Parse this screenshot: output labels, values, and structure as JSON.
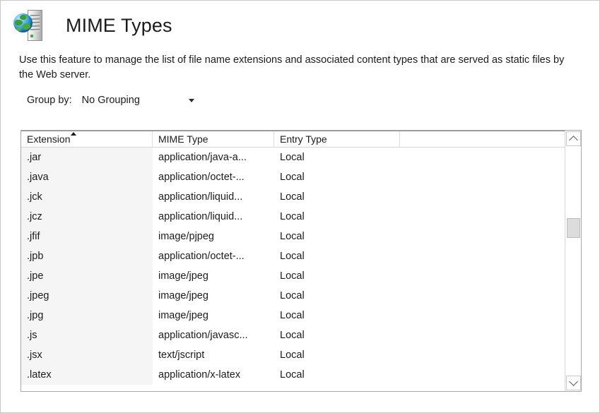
{
  "page": {
    "title": "MIME Types",
    "icon": "globe-server-icon",
    "description": "Use this feature to manage the list of file name extensions and associated content types that are served as static files by the Web server."
  },
  "toolbar": {
    "group_by_label": "Group by:",
    "group_by_value": "No Grouping",
    "group_by_caret": "chevron-down-icon"
  },
  "grid": {
    "columns": [
      {
        "label": "Extension",
        "sorted": "ascending"
      },
      {
        "label": "MIME Type",
        "sorted": ""
      },
      {
        "label": "Entry Type",
        "sorted": ""
      },
      {
        "label": "",
        "sorted": ""
      }
    ],
    "rows": [
      {
        "extension": ".jar",
        "mime_type": "application/java-a...",
        "entry_type": "Local"
      },
      {
        "extension": ".java",
        "mime_type": "application/octet-...",
        "entry_type": "Local"
      },
      {
        "extension": ".jck",
        "mime_type": "application/liquid...",
        "entry_type": "Local"
      },
      {
        "extension": ".jcz",
        "mime_type": "application/liquid...",
        "entry_type": "Local"
      },
      {
        "extension": ".jfif",
        "mime_type": "image/pjpeg",
        "entry_type": "Local"
      },
      {
        "extension": ".jpb",
        "mime_type": "application/octet-...",
        "entry_type": "Local"
      },
      {
        "extension": ".jpe",
        "mime_type": "image/jpeg",
        "entry_type": "Local"
      },
      {
        "extension": ".jpeg",
        "mime_type": "image/jpeg",
        "entry_type": "Local"
      },
      {
        "extension": ".jpg",
        "mime_type": "image/jpeg",
        "entry_type": "Local"
      },
      {
        "extension": ".js",
        "mime_type": "application/javasc...",
        "entry_type": "Local"
      },
      {
        "extension": ".jsx",
        "mime_type": "text/jscript",
        "entry_type": "Local"
      },
      {
        "extension": ".latex",
        "mime_type": "application/x-latex",
        "entry_type": "Local"
      }
    ]
  },
  "scrollbar": {
    "up_icon": "chevron-up-icon",
    "down_icon": "chevron-down-icon",
    "thumb_position_percent": 37
  },
  "colors": {
    "title_text": "#1b1b1b",
    "body_text": "#1b1b1b",
    "sorted_column_bg": "#f5f5f5",
    "grid_border": "#a9a9a9",
    "focus_outline": "#4a6fa5",
    "scroll_thumb": "#dcdcdc"
  }
}
